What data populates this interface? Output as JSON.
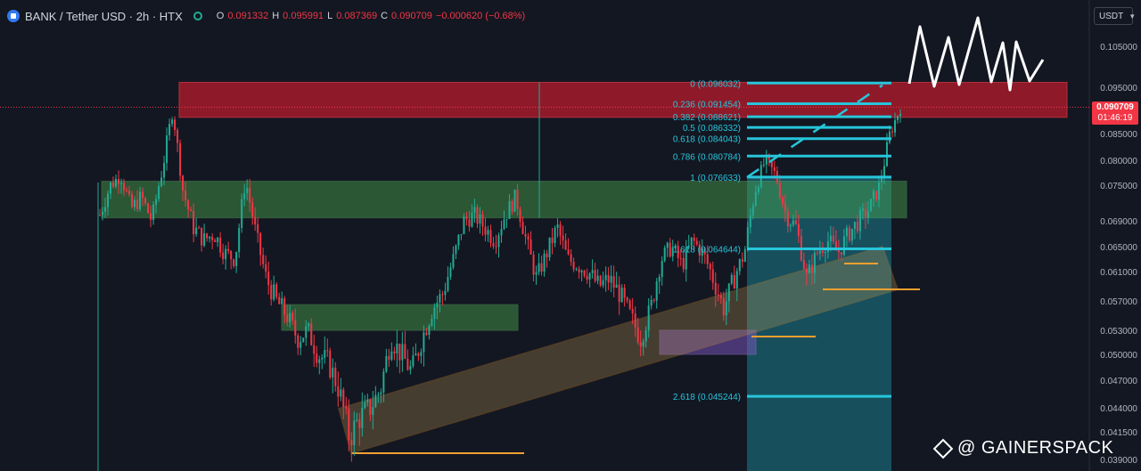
{
  "header": {
    "title": "BANK / Tether USD · 2h · HTX",
    "ohlc": [
      {
        "k": "O",
        "v": "0.091332"
      },
      {
        "k": "H",
        "v": "0.095991"
      },
      {
        "k": "L",
        "v": "0.087369"
      },
      {
        "k": "C",
        "v": "0.090709"
      },
      {
        "k": "",
        "v": "−0.000620 (−0.68%)"
      }
    ]
  },
  "currency_button": "USDT",
  "current_price": {
    "value": "0.090709",
    "countdown": "01:46:19"
  },
  "watermark": "@ GAINERSPACK",
  "colors": {
    "background": "#131722",
    "up": "#22ab94",
    "down": "#f23645",
    "fib": "#26c6da",
    "channel": "#f0a030",
    "resistance_zone": "#b71c2c",
    "support_zone": "#4caf50",
    "purple_zone": "#7e57c2"
  },
  "chart_data": {
    "type": "candlestick",
    "symbol": "BANK / Tether USD",
    "interval": "2h",
    "exchange": "HTX",
    "y_ticks": [
      "0.105000",
      "0.095000",
      "0.085000",
      "0.080000",
      "0.075000",
      "0.069000",
      "0.065000",
      "0.061000",
      "0.057000",
      "0.053000",
      "0.050000",
      "0.047000",
      "0.044000",
      "0.041500",
      "0.039000"
    ],
    "y_tick_values": [
      0.105,
      0.095,
      0.085,
      0.08,
      0.075,
      0.069,
      0.065,
      0.061,
      0.057,
      0.053,
      0.05,
      0.047,
      0.044,
      0.0415,
      0.039
    ],
    "price_path": [
      0.07,
      0.075,
      0.077,
      0.071,
      0.073,
      0.069,
      0.078,
      0.09,
      0.074,
      0.068,
      0.066,
      0.067,
      0.064,
      0.063,
      0.076,
      0.067,
      0.06,
      0.057,
      0.055,
      0.052,
      0.053,
      0.05,
      0.049,
      0.046,
      0.041,
      0.043,
      0.044,
      0.046,
      0.052,
      0.05,
      0.048,
      0.052,
      0.056,
      0.058,
      0.063,
      0.069,
      0.07,
      0.068,
      0.066,
      0.07,
      0.073,
      0.066,
      0.06,
      0.064,
      0.068,
      0.063,
      0.062,
      0.061,
      0.059,
      0.06,
      0.058,
      0.055,
      0.052,
      0.056,
      0.063,
      0.065,
      0.062,
      0.066,
      0.064,
      0.06,
      0.056,
      0.06,
      0.064,
      0.074,
      0.08,
      0.077,
      0.07,
      0.068,
      0.06,
      0.064,
      0.066,
      0.064,
      0.067,
      0.069,
      0.071,
      0.075,
      0.085,
      0.0907
    ],
    "fib_levels": [
      {
        "label": "0 (0.096032)",
        "value": 0.096032
      },
      {
        "label": "0.236 (0.091454)",
        "value": 0.091454
      },
      {
        "label": "0.382 (0.088621)",
        "value": 0.088621
      },
      {
        "label": "0.5 (0.086332)",
        "value": 0.086332
      },
      {
        "label": "0.618 (0.084043)",
        "value": 0.084043
      },
      {
        "label": "0.786 (0.080784)",
        "value": 0.080784
      },
      {
        "label": "1 (0.076633)",
        "value": 0.076633
      },
      {
        "label": "1.618 (0.064644)",
        "value": 0.064644
      },
      {
        "label": "2.618 (0.045244)",
        "value": 0.045244
      }
    ],
    "zones": [
      {
        "name": "resistance",
        "top": 0.0962,
        "bottom": 0.0885
      },
      {
        "name": "support-upper",
        "top": 0.0758,
        "bottom": 0.0695
      },
      {
        "name": "support-lower",
        "top": 0.0565,
        "bottom": 0.053
      },
      {
        "name": "purple",
        "top": 0.053,
        "bottom": 0.05
      }
    ]
  }
}
